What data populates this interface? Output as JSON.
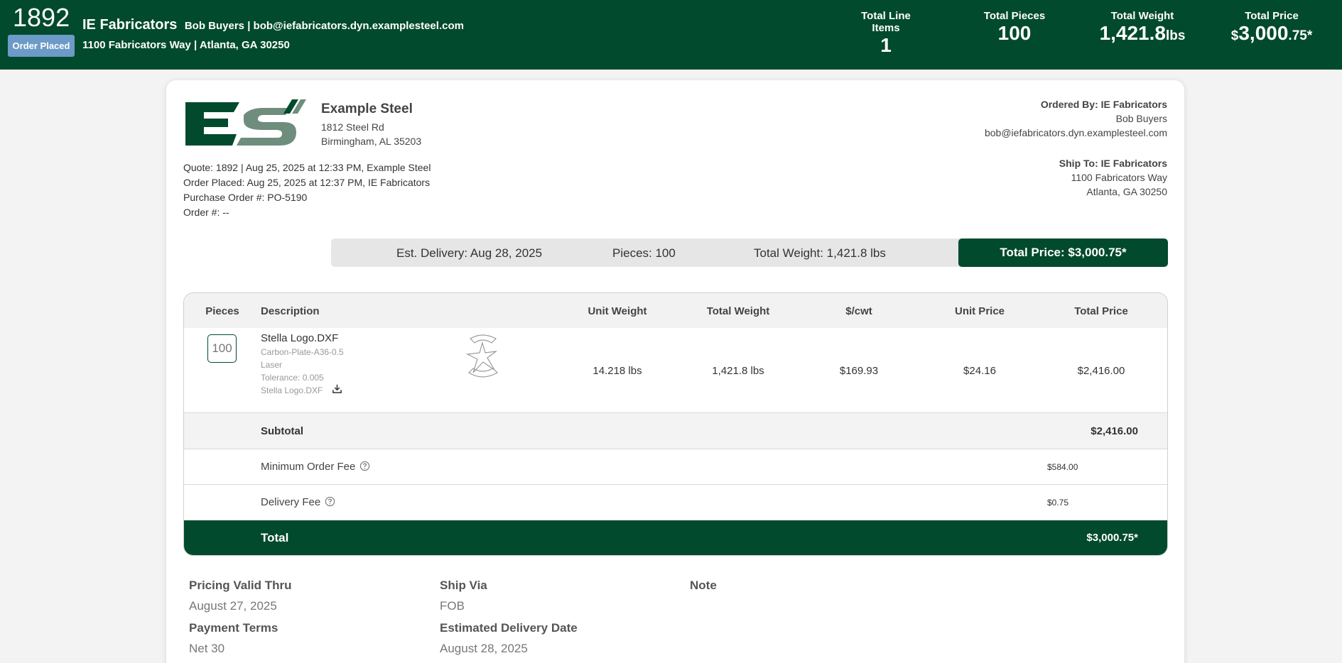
{
  "header": {
    "quote_number": "1892",
    "status": "Order Placed",
    "customer_name": "IE Fabricators",
    "customer_contact": "Bob Buyers | bob@iefabricators.dyn.examplesteel.com",
    "customer_address": "1100 Fabricators Way | Atlanta, GA 30250",
    "stats": [
      {
        "label": "Total Line Items",
        "value": "1",
        "unit": ""
      },
      {
        "label": "Total Pieces",
        "value": "100",
        "unit": ""
      },
      {
        "label": "Total Weight",
        "value": "1,421.8",
        "unit": "lbs"
      },
      {
        "label": "Total Price",
        "prefix": "$",
        "value": "3,000",
        "suffix": ".75*"
      }
    ]
  },
  "vendor": {
    "name": "Example Steel",
    "address_line1": "1812 Steel Rd",
    "address_line2": "Birmingham, AL 35203",
    "logo_colors": {
      "primary": "#024a2d",
      "secondary": "#6f8d7c"
    }
  },
  "meta": {
    "quote_line": "Quote: 1892 | Aug 25, 2025 at 12:33 PM, Example Steel",
    "order_placed_line": "Order Placed: Aug 25, 2025 at 12:37 PM, IE Fabricators",
    "po_line": "Purchase Order #: PO-5190",
    "order_line": "Order #: --"
  },
  "ordered_by": {
    "title": "Ordered By: IE Fabricators",
    "name": "Bob Buyers",
    "email": "bob@iefabricators.dyn.examplesteel.com"
  },
  "ship_to": {
    "title": "Ship To: IE Fabricators",
    "line1": "1100 Fabricators Way",
    "line2": "Atlanta, GA 30250"
  },
  "summary": {
    "delivery": "Est. Delivery: Aug 28, 2025",
    "pieces": "Pieces: 100",
    "weight": "Total Weight: 1,421.8 lbs",
    "total": "Total Price: $3,000.75*"
  },
  "table": {
    "columns": [
      "Pieces",
      "Description",
      "Unit Weight",
      "Total Weight",
      "$/cwt",
      "Unit Price",
      "Total Price"
    ],
    "items": [
      {
        "pieces": "100",
        "title": "Stella Logo.DXF",
        "material": "Carbon-Plate-A36-0.5",
        "process": "Laser",
        "tolerance": "Tolerance: 0.005",
        "file": "Stella Logo.DXF",
        "unit_weight": "14.218 lbs",
        "total_weight": "1,421.8 lbs",
        "cwt": "$169.93",
        "unit_price": "$24.16",
        "total_price": "$2,416.00"
      }
    ],
    "subtotal_label": "Subtotal",
    "subtotal_value": "$2,416.00",
    "fees": [
      {
        "label": "Minimum Order Fee",
        "value": "$584.00"
      },
      {
        "label": "Delivery Fee",
        "value": "$0.75"
      }
    ],
    "total_label": "Total",
    "total_value": "$3,000.75*"
  },
  "info": {
    "pricing_valid_label": "Pricing Valid Thru",
    "pricing_valid_value": "August 27, 2025",
    "ship_via_label": "Ship Via",
    "ship_via_value": "FOB",
    "note_label": "Note",
    "payment_terms_label": "Payment Terms",
    "payment_terms_value": "Net 30",
    "est_delivery_label": "Estimated Delivery Date",
    "est_delivery_value": "August 28, 2025"
  },
  "colors": {
    "brand": "#024a2d",
    "status_pill": "#6c9bc7",
    "summary_bg": "#e6e6e6"
  }
}
